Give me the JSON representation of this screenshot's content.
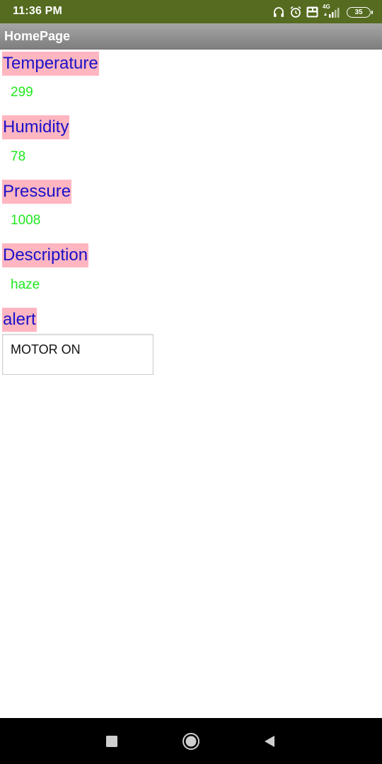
{
  "status_bar": {
    "time": "11:36 PM",
    "battery_level": "35",
    "network_label": "4G",
    "icons": [
      "headphones-icon",
      "alarm-icon",
      "volte-icon",
      "signal-icon",
      "battery-icon"
    ]
  },
  "app": {
    "title": "HomePage"
  },
  "fields": [
    {
      "label": "Temperature",
      "value": "299"
    },
    {
      "label": "Humidity",
      "value": "78"
    },
    {
      "label": "Pressure",
      "value": "1008"
    },
    {
      "label": "Description",
      "value": "haze"
    }
  ],
  "alert": {
    "label": "alert",
    "value": "MOTOR ON"
  },
  "nav_bar": {
    "icons": [
      "recents-square-icon",
      "home-circle-icon",
      "back-triangle-icon"
    ]
  },
  "colors": {
    "status_bar": "#556b1f",
    "label_background": "#ffb6c1",
    "label_text": "#1a10c8",
    "value_text": "#1fe81f"
  }
}
